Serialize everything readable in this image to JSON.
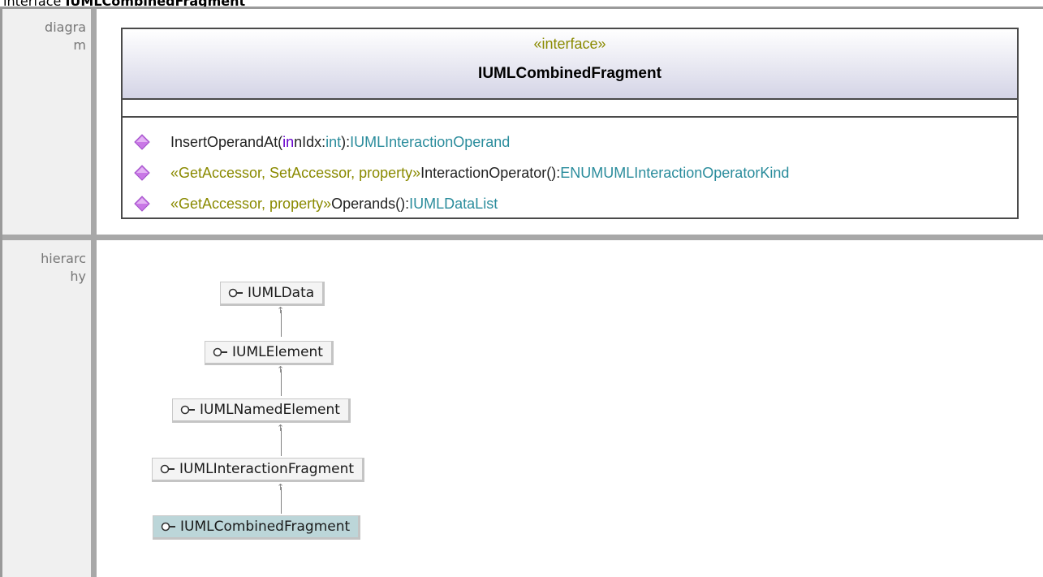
{
  "header": {
    "prefix": "interface",
    "name": "IUMLCombinedFragment"
  },
  "sections": [
    {
      "label": "diagram"
    },
    {
      "label": "hierarchy"
    }
  ],
  "interface_box": {
    "stereotype": "«interface»",
    "title": "IUMLCombinedFragment",
    "operations": [
      {
        "stereotype": "",
        "name": "InsertOperandAt(",
        "param_direction": "in",
        "param_name": " nIdx",
        "param_sep": ":",
        "param_type": "int",
        "close": "):",
        "return_type": "IUMLInteractionOperand"
      },
      {
        "stereotype": "«GetAccessor, SetAccessor, property»",
        "name": " InteractionOperator():",
        "return_type": "ENUMUMLInteractionOperatorKind"
      },
      {
        "stereotype": "«GetAccessor, property»",
        "name": " Operands():",
        "return_type": "IUMLDataList"
      }
    ]
  },
  "hierarchy": [
    {
      "name": "IUMLData",
      "current": false
    },
    {
      "name": "IUMLElement",
      "current": false
    },
    {
      "name": "IUMLNamedElement",
      "current": false
    },
    {
      "name": "IUMLInteractionFragment",
      "current": false
    },
    {
      "name": "IUMLCombinedFragment",
      "current": true
    }
  ],
  "icons": {
    "operation": "public-operation-diamond-icon",
    "interface": "interface-lollipop-icon"
  },
  "colors": {
    "operation_icon": "#c977e6",
    "link_type": "#2a8c9c",
    "keyword": "#6600cc",
    "stereotype": "#8a8a00",
    "current_node": "#bcd6d9",
    "label_bg": "#f0f0f0"
  }
}
